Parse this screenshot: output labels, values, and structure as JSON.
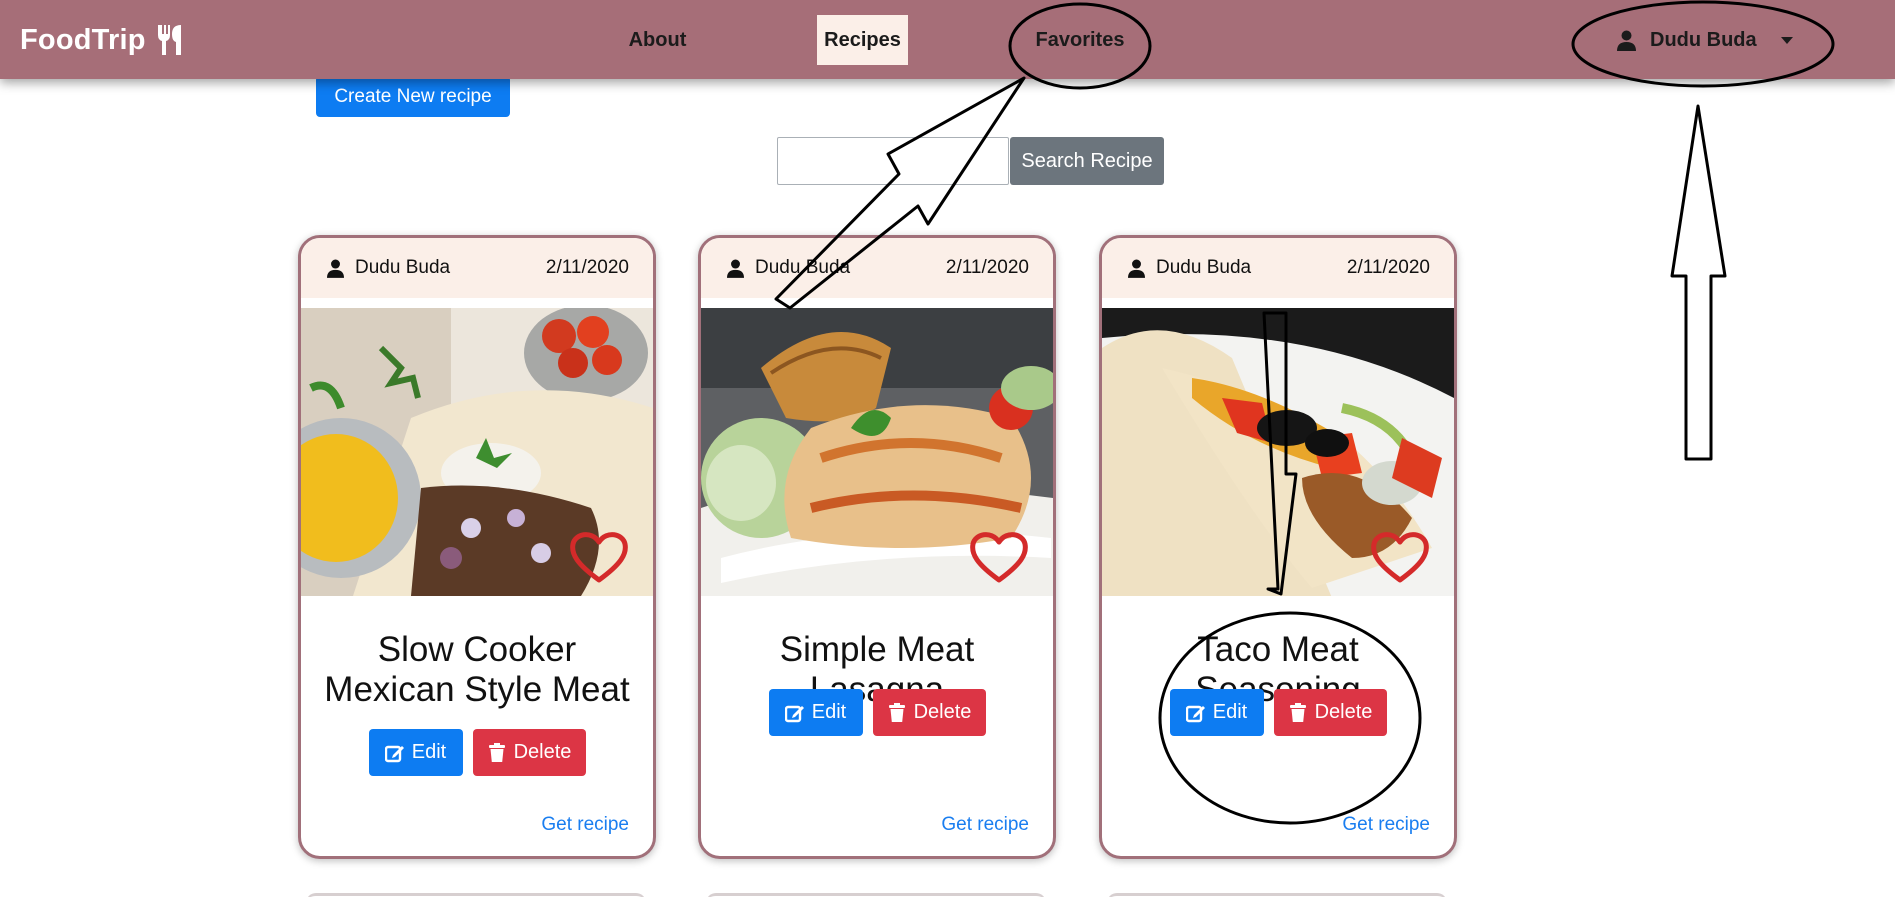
{
  "navbar": {
    "brand": "FoodTrip",
    "links": {
      "about": "About",
      "recipes": "Recipes",
      "favorites": "Favorites"
    },
    "user": "Dudu Buda"
  },
  "toolbar": {
    "create_label": "Create New recipe",
    "search_value": "",
    "search_label": "Search Recipe"
  },
  "cards": [
    {
      "author": "Dudu Buda",
      "date": "2/11/2020",
      "title": "Slow Cooker Mexican Style Meat",
      "edit": "Edit",
      "delete": "Delete",
      "link": "Get recipe"
    },
    {
      "author": "Dudu Buda",
      "date": "2/11/2020",
      "title": "Simple Meat Lasagna",
      "edit": "Edit",
      "delete": "Delete",
      "link": "Get recipe"
    },
    {
      "author": "Dudu Buda",
      "date": "2/11/2020",
      "title": "Taco Meat Seasoning",
      "edit": "Edit",
      "delete": "Delete",
      "link": "Get recipe"
    }
  ],
  "colors": {
    "navbar": "#a66e78",
    "active_tab": "#fbefe8",
    "primary": "#0d7cf2",
    "danger": "#dc3545",
    "secondary": "#6c757d",
    "card_border": "#a1707a"
  }
}
